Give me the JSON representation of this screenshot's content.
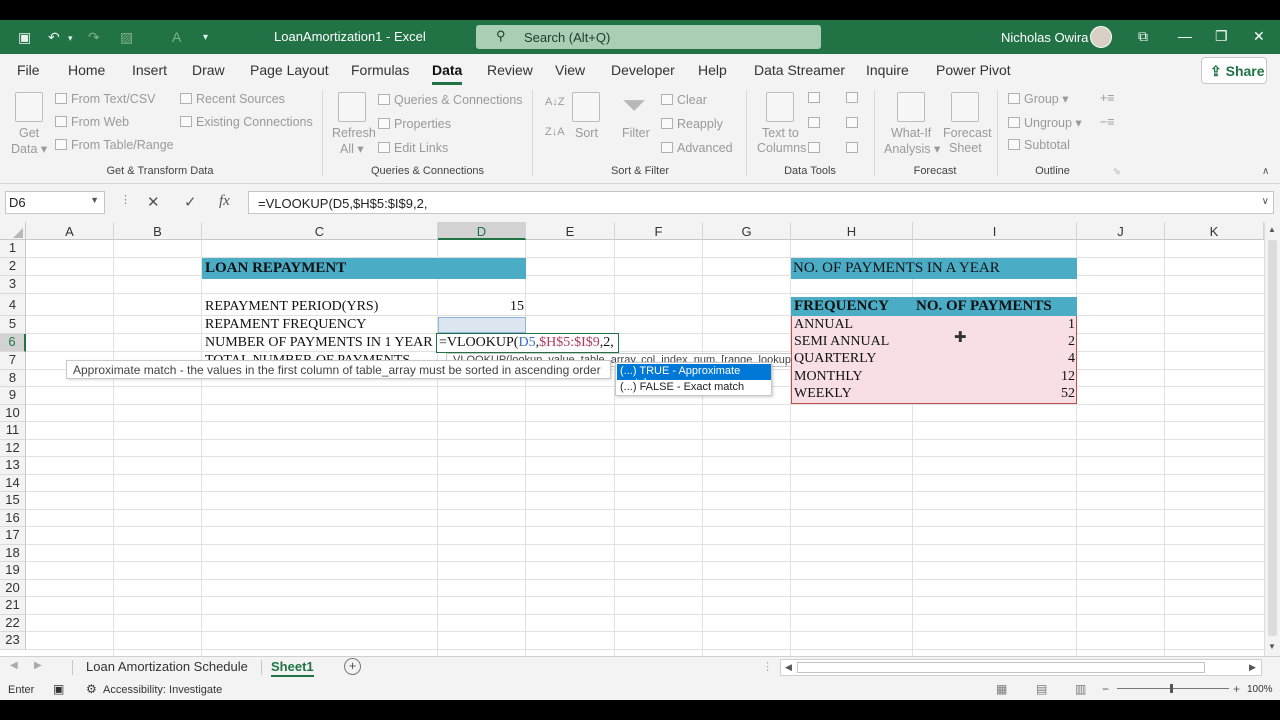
{
  "window": {
    "title": "LoanAmortization1  -  Excel",
    "search_placeholder": "Search (Alt+Q)",
    "user": "Nicholas Owira"
  },
  "ribbon_tabs": [
    "File",
    "Home",
    "Insert",
    "Draw",
    "Page Layout",
    "Formulas",
    "Data",
    "Review",
    "View",
    "Developer",
    "Help",
    "Data Streamer",
    "Inquire",
    "Power Pivot"
  ],
  "active_tab": "Data",
  "share_label": "Share",
  "ribbon": {
    "get_data": [
      "Get",
      "Data"
    ],
    "from_text_csv": "From Text/CSV",
    "from_web": "From Web",
    "from_table_range": "From Table/Range",
    "recent_sources": "Recent Sources",
    "existing_connections": "Existing Connections",
    "group_get_transform": "Get & Transform Data",
    "refresh_all": [
      "Refresh",
      "All"
    ],
    "queries_connections": "Queries & Connections",
    "properties": "Properties",
    "edit_links": "Edit Links",
    "group_queries": "Queries & Connections",
    "sort": "Sort",
    "filter": "Filter",
    "clear": "Clear",
    "reapply": "Reapply",
    "advanced": "Advanced",
    "group_sort_filter": "Sort & Filter",
    "text_to_columns": [
      "Text to",
      "Columns"
    ],
    "group_data_tools": "Data Tools",
    "what_if": [
      "What-If",
      "Analysis"
    ],
    "forecast_sheet": [
      "Forecast",
      "Sheet"
    ],
    "group_forecast": "Forecast",
    "group_btn": "Group",
    "ungroup_btn": "Ungroup",
    "subtotal": "Subtotal",
    "group_outline": "Outline"
  },
  "formula_bar": {
    "name_box": "D6",
    "formula": "=VLOOKUP(D5,$H$5:$I$9,2,"
  },
  "columns": [
    "A",
    "B",
    "C",
    "D",
    "E",
    "F",
    "G",
    "H",
    "I",
    "J",
    "K"
  ],
  "rows": [
    "1",
    "2",
    "3",
    "4",
    "5",
    "6",
    "7",
    "8",
    "9",
    "10",
    "11",
    "12",
    "13",
    "14",
    "15",
    "16",
    "17",
    "18",
    "19",
    "20",
    "21",
    "22",
    "23"
  ],
  "sheet": {
    "loan_title": "LOAN REPAYMENT",
    "repayment_period_label": "REPAYMENT PERIOD(YRS)",
    "repayment_period_value": "15",
    "repayment_frequency_label": "REPAMENT FREQUENCY",
    "num_payments_label": "NUMBER OF PAYMENTS IN 1 YEAR",
    "total_payments_label": "TOTAL NUMBER OF PAYMENTS",
    "edit_formula": {
      "prefix": "=VLOOKUP(",
      "arg1": "D5",
      "comma1": ",",
      "arg2": "$H$5:$I$9",
      "rest": ",2,"
    },
    "table_title": "NO. OF PAYMENTS IN A YEAR",
    "table_headers": [
      "FREQUENCY",
      "NO. OF PAYMENTS"
    ],
    "table_rows": [
      {
        "frequency": "ANNUAL",
        "payments": "1"
      },
      {
        "frequency": "SEMI ANNUAL",
        "payments": "2"
      },
      {
        "frequency": "QUARTERLY",
        "payments": "4"
      },
      {
        "frequency": "MONTHLY",
        "payments": "12"
      },
      {
        "frequency": "WEEKLY",
        "payments": "52"
      }
    ]
  },
  "tooltips": {
    "approx_match_hint": "Approximate match - the values in the first column of table_array must be sorted in ascending order",
    "signature": "VLOOKUP(lookup_value, table_array, col_index_num, [range_lookup])",
    "options": [
      {
        "icon": "(...)",
        "label": "TRUE - Approximate match"
      },
      {
        "icon": "(...)",
        "label": "FALSE - Exact match"
      }
    ]
  },
  "sheet_tabs": [
    "Loan Amortization Schedule",
    "Sheet1"
  ],
  "active_sheet": "Sheet1",
  "status": {
    "mode": "Enter",
    "accessibility": "Accessibility: Investigate",
    "zoom": "100%"
  },
  "colors": {
    "excel_green": "#217346",
    "header_teal": "#4bacc6",
    "table_pink": "#f8dfe3",
    "table_border": "#c0504d",
    "selection_blue": "#0078d7"
  }
}
